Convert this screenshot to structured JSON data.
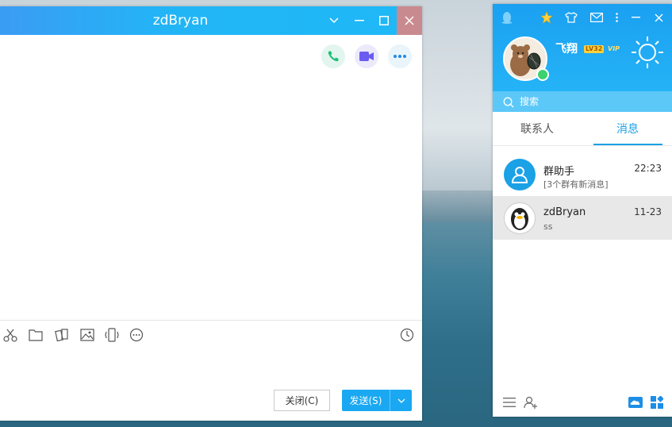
{
  "chat": {
    "title": "zdBryan",
    "close_label": "关闭(C)",
    "send_label": "发送(S)"
  },
  "qq": {
    "nickname": "飞翔",
    "level_badge": "LV32",
    "vip_badge": "VIP",
    "search_placeholder": "搜索",
    "tabs": {
      "contacts": "联系人",
      "messages": "消息"
    },
    "conversations": [
      {
        "title": "群助手",
        "time": "22:23",
        "preview": "[3个群有新消息]"
      },
      {
        "title": "zdBryan",
        "time": "11-23",
        "preview": "ss"
      }
    ]
  },
  "colors": {
    "accent": "#1aa8f2",
    "title_bar": "#22b5f6",
    "close_hover": "#c98a8f",
    "online": "#3bd16f"
  },
  "icons": [
    "penguin-icon",
    "star-icon",
    "shirt-icon",
    "mail-icon",
    "more-vert-icon",
    "minimize-icon",
    "close-icon",
    "sun-icon",
    "search-icon",
    "phone-icon",
    "video-icon",
    "more-icon",
    "scissors-icon",
    "folder-icon",
    "magic-icon",
    "image-icon",
    "shake-icon",
    "emoji-icon",
    "history-icon",
    "menu-icon",
    "add-friend-icon",
    "cloud-icon",
    "apps-icon"
  ]
}
